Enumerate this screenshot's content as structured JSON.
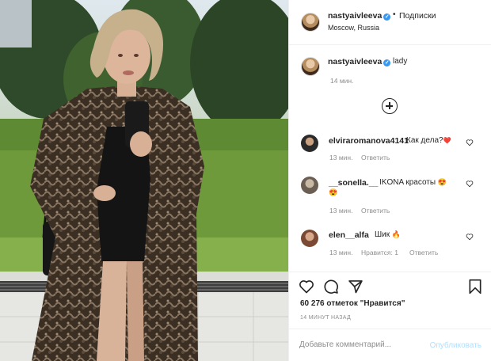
{
  "colors": {
    "accent": "#3897f0",
    "muted": "#8e8e8e",
    "text": "#262626",
    "publish_disabled": "#b2dffc"
  },
  "post": {
    "username": "nastyaivleeva",
    "follow_label": "Подписки",
    "location": "Moscow, Russia",
    "caption": "lady",
    "caption_time": "14 мин."
  },
  "comments": [
    {
      "user": "elviraromanova4141",
      "text": "Как дела?",
      "emoji": "❤️",
      "time": "13 мин.",
      "reply": "Ответить"
    },
    {
      "user": "__sonella.__",
      "text": "IKONA красоты",
      "emoji": "😍",
      "emoji2": "😍",
      "time": "13 мин.",
      "reply": "Ответить"
    },
    {
      "user": "elen__alfa",
      "text": "Шик",
      "emoji": "🔥",
      "time": "13 мин.",
      "likes": "Нравится: 1",
      "reply": "Ответить"
    }
  ],
  "icons": [
    "heart-icon",
    "comment-icon",
    "share-icon",
    "bookmark-icon",
    "plus-circle-icon",
    "more-icon",
    "verified-icon"
  ],
  "stats": {
    "likes": "60 276 отметок \"Нравится\"",
    "posted": "14 МИНУТ НАЗАД"
  },
  "add_comment": {
    "placeholder": "Добавьте комментарий...",
    "publish": "Опубликовать"
  }
}
